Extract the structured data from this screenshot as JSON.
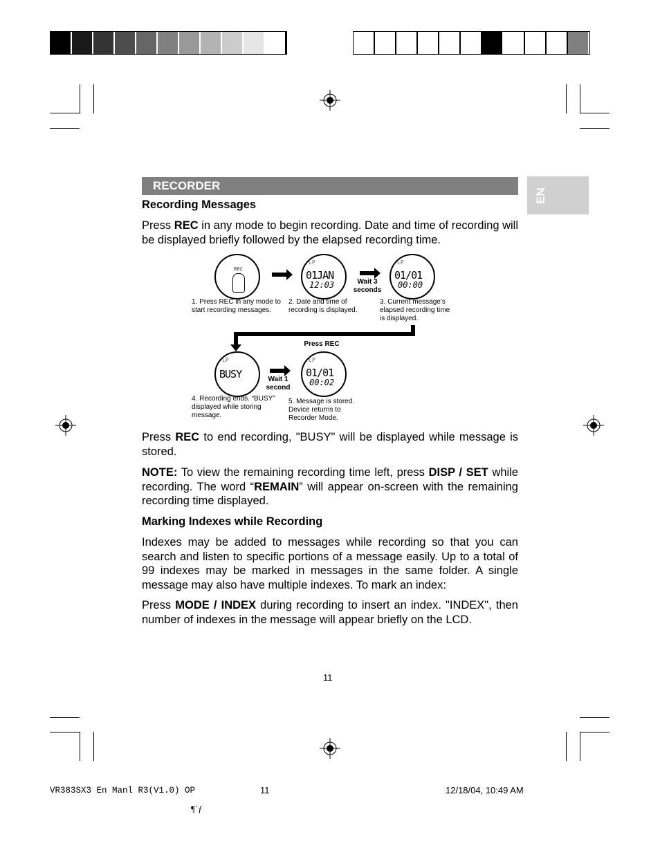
{
  "colors": {
    "section_bar": "#808080",
    "tab": "#d0d0d0",
    "left_swatches": [
      "#000000",
      "#1a1a1a",
      "#333333",
      "#4d4d4d",
      "#666666",
      "#808080",
      "#999999",
      "#b3b3b3",
      "#cccccc",
      "#e6e6e6",
      "#ffffff"
    ],
    "right_swatches": [
      "#ffffff",
      "#ffffff",
      "#ffffff",
      "#ffffff",
      "#ffffff",
      "#ffffff",
      "#000000",
      "#ffffff",
      "#ffffff",
      "#ffffff",
      "#808080"
    ]
  },
  "section_title": "RECORDER",
  "side_tab": "EN",
  "heading1": "Recording Messages",
  "para1": {
    "a": "Press ",
    "b": "REC",
    "c": " in any mode to begin recording. Date and time of recording will be displayed briefly followed by the elapsed recording time."
  },
  "diagram": {
    "device_label": "REC",
    "lcd2": {
      "mode": "LP",
      "line1": "01JAN",
      "line2": "12:03"
    },
    "lcd3": {
      "mode": "LP",
      "line1": "01/01",
      "line2": "00:00"
    },
    "lcd4": {
      "mode": "LP",
      "line1": "BUSY"
    },
    "lcd5": {
      "mode": "LP",
      "line1": "01/01",
      "line2": "00:02"
    },
    "wait3": "Wait 3 seconds",
    "wait1": "Wait 1 second",
    "press_rec": "Press REC",
    "cap1": "1. Press REC in any mode to start recording messages.",
    "cap2": "2. Date and time of recording is displayed.",
    "cap3": "3. Current message’s elapsed recording time is displayed.",
    "cap4": "4. Recording ends. “BUSY” displayed while storing message.",
    "cap5": "5. Message is stored. Device returns to Recorder Mode."
  },
  "para2": {
    "a": "Press ",
    "b": "REC",
    "c": " to end recording, \"BUSY\" will be displayed while message is stored."
  },
  "note": {
    "a": "NOTE:",
    "b": " To view the remaining recording time left, press ",
    "c": "DISP / SET",
    "d": " while recording. The word “",
    "e": "REMAIN",
    "f": "” will appear on-screen with the remaining recording time displayed."
  },
  "heading2": "Marking Indexes while Recording",
  "para3": "Indexes may be added to messages while recording so that you can search and listen to specific portions of a message easily. Up to a total of 99 indexes may be marked in messages in the same folder. A single message may also have multiple indexes. To mark an index:",
  "para4": {
    "a": "Press ",
    "b": "MODE / INDEX",
    "c": " during recording to insert an index.  \"INDEX\", then number of indexes in the message will appear briefly on the LCD."
  },
  "page_number": "11",
  "footer": {
    "file": "VR383SX3 En Manl R3(V1.0) OP",
    "page": "11",
    "date": "12/18/04, 10:49 AM",
    "garble": "¶´ƒ"
  }
}
